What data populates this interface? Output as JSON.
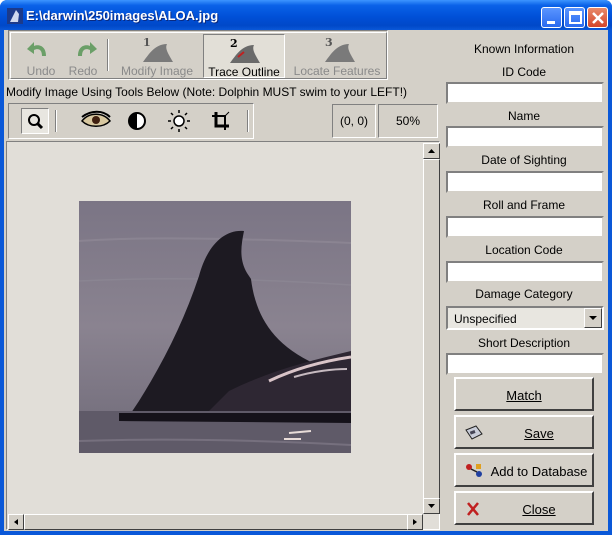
{
  "window": {
    "title": "E:\\darwin\\250images\\ALOA.jpg",
    "title_color": "#ffffff",
    "titlebar_color": "#0a58d8"
  },
  "toolbar": {
    "undo_label": "Undo",
    "redo_label": "Redo",
    "modify_label": "Modify Image",
    "modify_step": "1",
    "trace_label": "Trace Outline",
    "trace_step": "2",
    "locate_label": "Locate Features",
    "locate_step": "3"
  },
  "instruction": "Modify Image Using Tools Below (Note: Dolphin MUST swim to your LEFT!)",
  "image_tools": {
    "items": [
      "magnify-icon",
      "eye-icon",
      "contrast-icon",
      "brightness-icon",
      "crop-icon"
    ],
    "active": "magnify-icon"
  },
  "status": {
    "coords": "(0, 0)",
    "zoom": "50%"
  },
  "panel": {
    "header": "Known Information",
    "id_code_label": "ID Code",
    "id_code_value": "",
    "name_label": "Name",
    "name_value": "",
    "date_label": "Date of Sighting",
    "date_value": "",
    "roll_label": "Roll and Frame",
    "roll_value": "",
    "location_label": "Location Code",
    "location_value": "",
    "damage_label": "Damage Category",
    "damage_value": "Unspecified",
    "description_label": "Short Description",
    "description_value": ""
  },
  "actions": {
    "match_label": "Match",
    "save_label": "Save",
    "add_label": "Add to Database",
    "close_label": "Close"
  }
}
